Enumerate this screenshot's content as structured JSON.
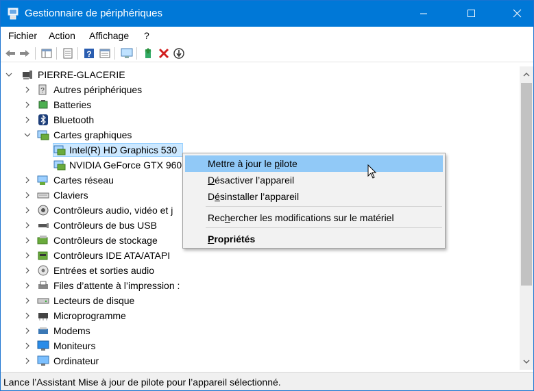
{
  "window": {
    "title": "Gestionnaire de périphériques",
    "accent_color": "#0078d7"
  },
  "menu": [
    "Fichier",
    "Action",
    "Affichage",
    "?"
  ],
  "toolbar_icons": [
    "back-arrow-icon",
    "forward-arrow-icon",
    "show-hide-tree-icon",
    "properties-icon",
    "help-icon",
    "view-icon",
    "monitor-scan-icon",
    "update-driver-icon",
    "uninstall-icon",
    "disable-icon"
  ],
  "tree": {
    "root": "PIERRE-GLACERIE",
    "items": [
      {
        "label": "Autres périphériques",
        "icon": "unknown-device-icon",
        "expanded": false
      },
      {
        "label": "Batteries",
        "icon": "battery-icon",
        "expanded": false
      },
      {
        "label": "Bluetooth",
        "icon": "bluetooth-icon",
        "expanded": false
      },
      {
        "label": "Cartes graphiques",
        "icon": "display-adapter-icon",
        "expanded": true
      },
      {
        "label": "Intel(R) HD Graphics 530",
        "icon": "display-adapter-icon",
        "child": true,
        "selected": true
      },
      {
        "label": "NVIDIA GeForce GTX 960",
        "icon": "display-adapter-icon",
        "child": true
      },
      {
        "label": "Cartes réseau",
        "icon": "network-adapter-icon",
        "expanded": false
      },
      {
        "label": "Claviers",
        "icon": "keyboard-icon",
        "expanded": false
      },
      {
        "label": "Contrôleurs audio, vidéo et j",
        "icon": "speaker-icon",
        "expanded": false
      },
      {
        "label": "Contrôleurs de bus USB",
        "icon": "usb-icon",
        "expanded": false
      },
      {
        "label": "Contrôleurs de stockage",
        "icon": "storage-controller-icon",
        "expanded": false
      },
      {
        "label": "Contrôleurs IDE ATA/ATAPI",
        "icon": "ide-controller-icon",
        "expanded": false
      },
      {
        "label": "Entrées et sorties audio",
        "icon": "audio-io-icon",
        "expanded": false
      },
      {
        "label": "Files d’attente à l’impression :",
        "icon": "printer-queue-icon",
        "expanded": false
      },
      {
        "label": "Lecteurs de disque",
        "icon": "disk-drive-icon",
        "expanded": false
      },
      {
        "label": "Microprogramme",
        "icon": "firmware-icon",
        "expanded": false
      },
      {
        "label": "Modems",
        "icon": "modem-icon",
        "expanded": false
      },
      {
        "label": "Moniteurs",
        "icon": "monitor-icon",
        "expanded": false
      },
      {
        "label": "Ordinateur",
        "icon": "computer-icon",
        "expanded": false
      }
    ]
  },
  "context_menu": {
    "update_driver": {
      "pre": "Mettre à jour le ",
      "accel": "p",
      "post": "ilote"
    },
    "disable_device": {
      "pre": "",
      "accel": "D",
      "post": "ésactiver l’appareil"
    },
    "uninstall_device": {
      "pre": "D",
      "accel": "é",
      "post": "sinstaller l’appareil"
    },
    "scan_hardware": {
      "pre": "Rec",
      "accel": "h",
      "post": "ercher les modifications sur le matériel"
    },
    "properties": {
      "pre": "",
      "accel": "P",
      "post": "ropriétés"
    }
  },
  "status": "Lance l’Assistant Mise à jour de pilote pour l’appareil sélectionné."
}
